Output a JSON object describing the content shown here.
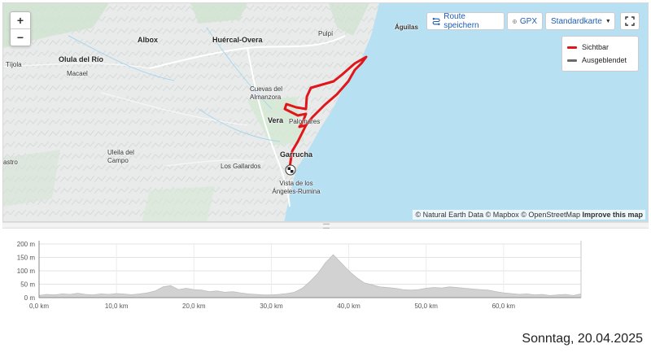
{
  "map": {
    "zoom_in": "+",
    "zoom_out": "−",
    "toolbar": {
      "save_route": "Route speichern",
      "gpx": "GPX",
      "basemap": "Standardkarte",
      "fullscreen_icon": "fullscreen-icon"
    },
    "legend": [
      {
        "label": "Sichtbar",
        "color": "#e0161b"
      },
      {
        "label": "Ausgeblendet",
        "color": "#6b6b6b"
      }
    ],
    "places": [
      "Águilas",
      "Pulpí",
      "Albox",
      "Huércal-Overa",
      "Tíjola",
      "Olula del Río",
      "Macael",
      "Cuevas del Almanzora",
      "Vera",
      "Palomares",
      "Garrucha",
      "Uleila del Campo",
      "Los Gallardos",
      "Vista de los Ángeles-Rumina",
      "astro"
    ],
    "attribution": {
      "text": "© Natural Earth Data © Mapbox © OpenStreetMap ",
      "link": "Improve this map"
    },
    "colors": {
      "sea": "#b7e0f3",
      "land": "#e9ecec",
      "route": "#e0161b"
    }
  },
  "profile": {
    "y_ticks": [
      "200 m",
      "150 m",
      "100 m",
      "50 m",
      "0 m"
    ],
    "x_ticks": [
      "0,0 km",
      "10,0 km",
      "20,0 km",
      "30,0 km",
      "40,0 km",
      "50,0 km",
      "60,0 km"
    ]
  },
  "chart_data": {
    "type": "area",
    "xlabel": "",
    "ylabel": "",
    "x_unit": "km",
    "y_unit": "m",
    "xlim": [
      0,
      70
    ],
    "ylim": [
      0,
      200
    ],
    "grid": true,
    "x": [
      0,
      1,
      2,
      3,
      4,
      5,
      6,
      7,
      8,
      9,
      10,
      11,
      12,
      13,
      14,
      15,
      16,
      17,
      18,
      19,
      20,
      21,
      22,
      23,
      24,
      25,
      26,
      27,
      28,
      29,
      30,
      31,
      32,
      33,
      34,
      35,
      36,
      37,
      38,
      39,
      40,
      41,
      42,
      43,
      44,
      45,
      46,
      47,
      48,
      49,
      50,
      51,
      52,
      53,
      54,
      55,
      56,
      57,
      58,
      59,
      60,
      61,
      62,
      63,
      64,
      65,
      66,
      67,
      68,
      69,
      70
    ],
    "values": [
      8,
      12,
      10,
      14,
      12,
      16,
      12,
      10,
      14,
      12,
      15,
      13,
      11,
      14,
      18,
      25,
      40,
      45,
      30,
      35,
      30,
      28,
      22,
      25,
      20,
      22,
      18,
      14,
      12,
      10,
      10,
      12,
      15,
      20,
      35,
      60,
      90,
      130,
      160,
      130,
      100,
      75,
      55,
      48,
      40,
      38,
      35,
      30,
      28,
      30,
      35,
      38,
      36,
      40,
      38,
      35,
      32,
      30,
      28,
      22,
      18,
      15,
      12,
      14,
      10,
      12,
      8,
      10,
      12,
      8,
      14
    ]
  },
  "footer": {
    "date": "Sonntag, 20.04.2025"
  }
}
